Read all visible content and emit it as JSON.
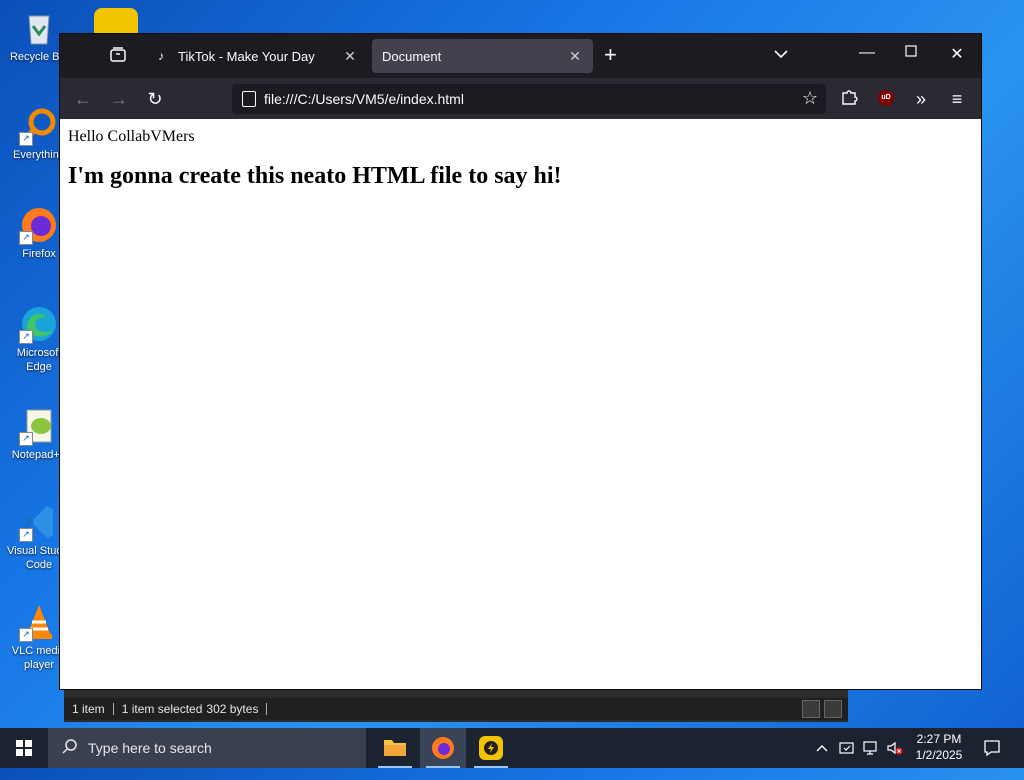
{
  "desktop": {
    "icons": [
      {
        "label": "Recycle Bin",
        "icon": "recycle-bin-icon"
      },
      {
        "label": "Everything",
        "icon": "everything-search-icon"
      },
      {
        "label": "Firefox",
        "icon": "firefox-icon"
      },
      {
        "label": "Microsoft Edge",
        "icon": "edge-icon"
      },
      {
        "label": "Notepad++",
        "icon": "notepad-plus-plus-icon"
      },
      {
        "label": "Visual Studio Code",
        "icon": "vscode-icon"
      },
      {
        "label": "VLC media player",
        "icon": "vlc-icon"
      }
    ]
  },
  "explorer": {
    "item_count": "1 item",
    "selected": "1 item selected",
    "size": "302 bytes"
  },
  "browser": {
    "tabs": [
      {
        "title": "TikTok - Make Your Day",
        "active": false
      },
      {
        "title": "Document",
        "active": true
      }
    ],
    "url": "file:///C:/Users/VM5/e/index.html",
    "extension_badge": "uD"
  },
  "page": {
    "paragraph": "Hello CollabVMers",
    "heading": "I'm gonna create this neato HTML file to say hi!"
  },
  "taskbar": {
    "search_placeholder": "Type here to search",
    "time": "2:27 PM",
    "date": "1/2/2025"
  }
}
